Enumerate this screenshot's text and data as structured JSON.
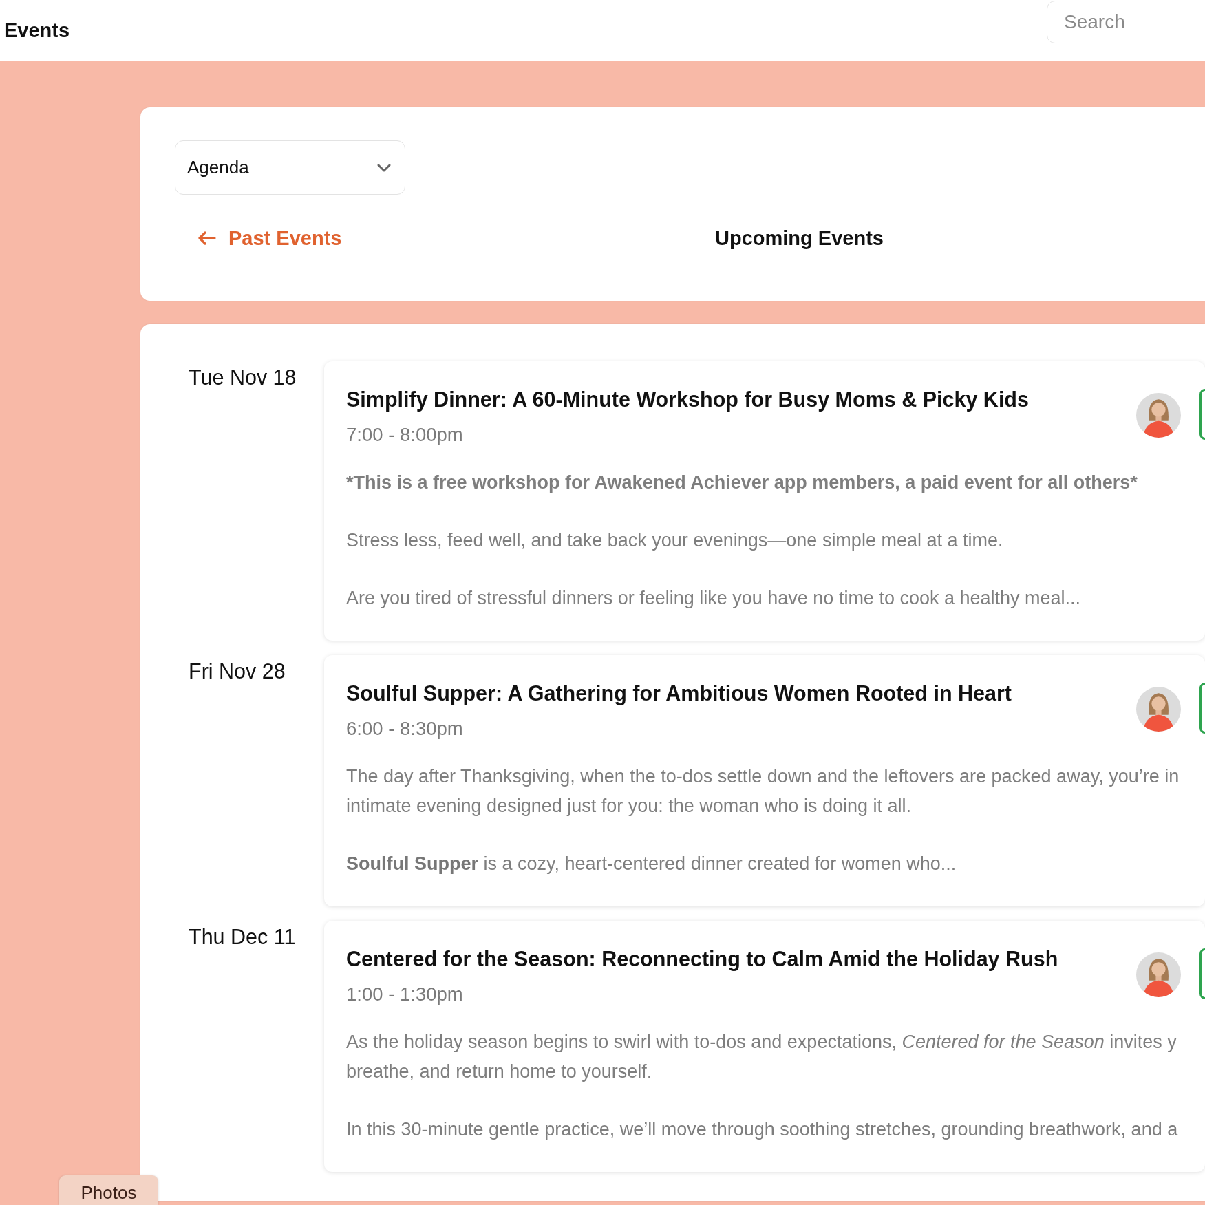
{
  "header": {
    "title": "Events",
    "search": {
      "placeholder": "Search"
    }
  },
  "toolbar": {
    "view": "Agenda",
    "past_link": "Past Events",
    "heading": "Upcoming Events"
  },
  "events": [
    {
      "date": "Tue Nov 18",
      "title": "Simplify Dinner: A 60-Minute Workshop for Busy Moms & Picky Kids",
      "time": "7:00 - 8:00pm",
      "paragraphs": [
        {
          "kind": "note",
          "lines": [
            "*This is a free workshop for Awakened Achiever app members, a paid event for all others*"
          ]
        },
        {
          "kind": "text",
          "lines": [
            "Stress less, feed well, and take back your evenings—one simple meal at a time."
          ]
        },
        {
          "kind": "text",
          "lines": [
            "Are you tired of stressful dinners or feeling like you have no time to cook a healthy meal..."
          ]
        }
      ]
    },
    {
      "date": "Fri Nov 28",
      "title": "Soulful Supper: A Gathering for Ambitious Women Rooted in Heart",
      "time": "6:00 - 8:30pm",
      "paragraphs": [
        {
          "kind": "text",
          "lines": [
            "The day after Thanksgiving, when the to-dos settle down and the leftovers are packed away, you’re in",
            "intimate evening designed just for you: the woman who is doing it all."
          ]
        },
        {
          "kind": "text",
          "lines": [
            "**Soulful Supper** is a cozy, heart-centered dinner created for women who..."
          ]
        }
      ]
    },
    {
      "date": "Thu Dec 11",
      "title": "Centered for the Season: Reconnecting to Calm Amid the Holiday Rush",
      "time": "1:00 - 1:30pm",
      "paragraphs": [
        {
          "kind": "text",
          "lines": [
            "As the holiday season begins to swirl with to-dos and expectations, *Centered for the Season* invites y",
            "breathe, and return home to yourself."
          ]
        },
        {
          "kind": "text",
          "lines": [
            "In this 30-minute gentle practice, we’ll move through soothing stretches, grounding breathwork, and a"
          ]
        }
      ]
    }
  ],
  "footer_tab": "Photos"
}
